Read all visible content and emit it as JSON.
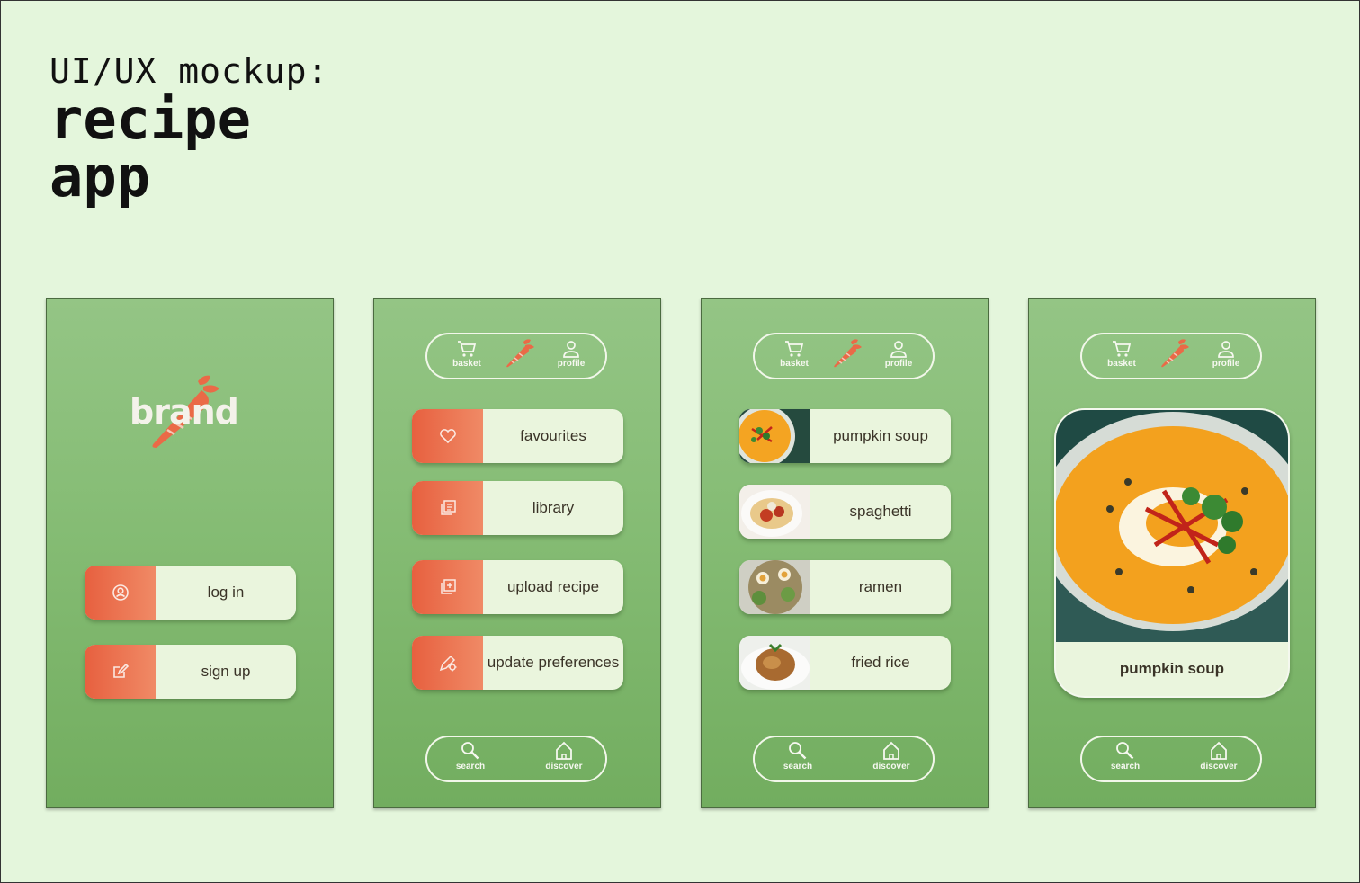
{
  "title": {
    "line1": "UI/UX mockup:",
    "line2": "recipe",
    "line3": "app"
  },
  "brand": {
    "name": "brand"
  },
  "nav": {
    "top": {
      "basket": "basket",
      "profile": "profile"
    },
    "bottom": {
      "search": "search",
      "discover": "discover"
    }
  },
  "screen1": {
    "login": "log in",
    "signup": "sign up"
  },
  "screen2": {
    "items": [
      {
        "label": "favourites",
        "icon": "heart-icon"
      },
      {
        "label": "library",
        "icon": "library-icon"
      },
      {
        "label": "upload recipe",
        "icon": "upload-icon"
      },
      {
        "label": "update preferences",
        "icon": "preferences-icon"
      }
    ]
  },
  "screen3": {
    "items": [
      {
        "label": "pumpkin soup"
      },
      {
        "label": "spaghetti"
      },
      {
        "label": "ramen"
      },
      {
        "label": "fried rice"
      }
    ]
  },
  "screen4": {
    "caption": "pumpkin soup"
  },
  "colors": {
    "background": "#e4f6dc",
    "screen": "#85bc74",
    "accent": "#e7603f",
    "card": "#eaf5dd"
  }
}
